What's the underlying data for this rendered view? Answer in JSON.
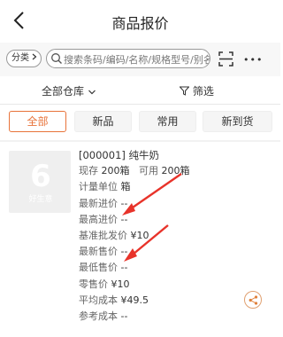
{
  "header": {
    "title": "商品报价"
  },
  "search": {
    "category_label": "分类",
    "placeholder": "搜索条码/编码/名称/规格型号/别名"
  },
  "filter_bar": {
    "warehouse": "全部仓库",
    "filter": "筛选"
  },
  "tabs": [
    {
      "label": "全部",
      "active": true
    },
    {
      "label": "新品",
      "active": false
    },
    {
      "label": "常用",
      "active": false
    },
    {
      "label": "新到货",
      "active": false
    }
  ],
  "product": {
    "name": "[000001] 纯牛奶",
    "thumb_logo_text": "好生意",
    "stock_label": "现存",
    "stock_value": "200箱",
    "available_label": "可用",
    "available_value": "200箱",
    "unit_label": "计量单位",
    "unit_value": "箱",
    "latest_purchase_label": "最新进价",
    "latest_purchase_value": "--",
    "max_purchase_label": "最高进价",
    "max_purchase_value": "--",
    "base_wholesale_label": "基准批发价",
    "base_wholesale_value": "¥10",
    "latest_sale_label": "最新售价",
    "latest_sale_value": "--",
    "min_sale_label": "最低售价",
    "min_sale_value": "--",
    "retail_label": "零售价",
    "retail_value": "¥10",
    "avg_cost_label": "平均成本",
    "avg_cost_value": "¥49.5",
    "ref_cost_label": "参考成本",
    "ref_cost_value": "--"
  },
  "icons": {
    "back": "back-arrow-icon",
    "search": "search-icon",
    "scan": "scan-icon",
    "more": "more-icon",
    "chevron": "chevron-down-icon",
    "funnel": "funnel-icon",
    "share": "share-icon"
  },
  "colors": {
    "accent": "#e8733a",
    "annotation_arrow": "#e8332a"
  }
}
